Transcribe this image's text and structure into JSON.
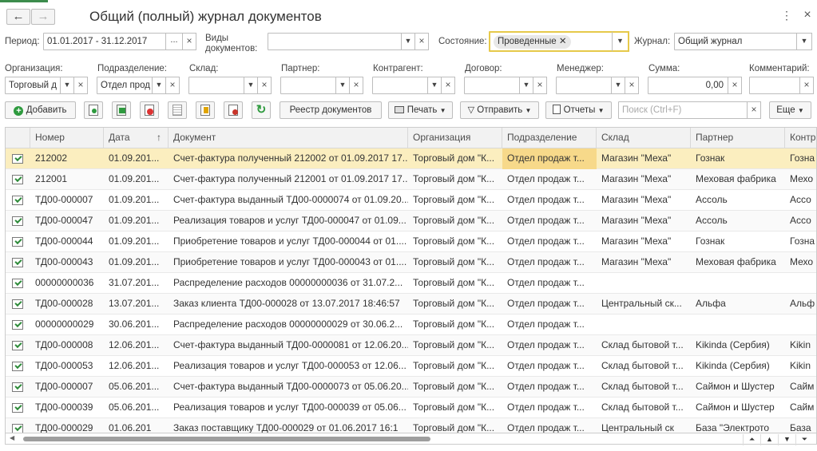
{
  "window": {
    "title": "Общий (полный) журнал документов",
    "more_icon": "⋮",
    "close_icon": "×"
  },
  "filters": {
    "period_label": "Период:",
    "period_value": "01.01.2017 - 31.12.2017",
    "period_btn": "...",
    "doc_types_label": "Виды документов:",
    "state_label": "Состояние:",
    "state_tag": "Проведенные",
    "journal_label": "Журнал:",
    "journal_value": "Общий журнал",
    "org_label": "Организация:",
    "org_value": "Торговый д",
    "dept_label": "Подразделение:",
    "dept_value": "Отдел прод",
    "warehouse_label": "Склад:",
    "partner_label": "Партнер:",
    "counterparty_label": "Контрагент:",
    "contract_label": "Договор:",
    "manager_label": "Менеджер:",
    "sum_label": "Сумма:",
    "sum_value": "0,00",
    "comment_label": "Комментарий:"
  },
  "toolbar": {
    "add": "Добавить",
    "registry": "Реестр документов",
    "print": "Печать",
    "send": "Отправить",
    "reports": "Отчеты",
    "search_placeholder": "Поиск (Ctrl+F)",
    "more": "Еще"
  },
  "columns": [
    "Номер",
    "Дата",
    "Документ",
    "Организация",
    "Подразделение",
    "Склад",
    "Партнер",
    "Контр"
  ],
  "sort_indicator": "↑",
  "rows": [
    {
      "num": "212002",
      "date": "01.09.201...",
      "doc": "Счет-фактура полученный 212002 от 01.09.2017 17...",
      "org": "Торговый дом \"К...",
      "dept": "Отдел продаж т...",
      "wh": "Магазин \"Меха\"",
      "partner": "Гознак",
      "contr": "Гозна"
    },
    {
      "num": "212001",
      "date": "01.09.201...",
      "doc": "Счет-фактура полученный 212001 от 01.09.2017 17...",
      "org": "Торговый дом \"К...",
      "dept": "Отдел продаж т...",
      "wh": "Магазин \"Меха\"",
      "partner": "Меховая фабрика",
      "contr": "Мехо"
    },
    {
      "num": "ТД00-000007",
      "date": "01.09.201...",
      "doc": "Счет-фактура выданный ТД00-0000074 от 01.09.20...",
      "org": "Торговый дом \"К...",
      "dept": "Отдел продаж т...",
      "wh": "Магазин \"Меха\"",
      "partner": "Ассоль",
      "contr": "Ассо"
    },
    {
      "num": "ТД00-000047",
      "date": "01.09.201...",
      "doc": "Реализация товаров и услуг ТД00-000047 от 01.09...",
      "org": "Торговый дом \"К...",
      "dept": "Отдел продаж т...",
      "wh": "Магазин \"Меха\"",
      "partner": "Ассоль",
      "contr": "Ассо"
    },
    {
      "num": "ТД00-000044",
      "date": "01.09.201...",
      "doc": "Приобретение товаров и услуг ТД00-000044 от 01....",
      "org": "Торговый дом \"К...",
      "dept": "Отдел продаж т...",
      "wh": "Магазин \"Меха\"",
      "partner": "Гознак",
      "contr": "Гозна"
    },
    {
      "num": "ТД00-000043",
      "date": "01.09.201...",
      "doc": "Приобретение товаров и услуг ТД00-000043 от 01....",
      "org": "Торговый дом \"К...",
      "dept": "Отдел продаж т...",
      "wh": "Магазин \"Меха\"",
      "partner": "Меховая фабрика",
      "contr": "Мехо"
    },
    {
      "num": "00000000036",
      "date": "31.07.201...",
      "doc": "Распределение расходов 00000000036 от 31.07.2...",
      "org": "Торговый дом \"К...",
      "dept": "Отдел продаж т...",
      "wh": "",
      "partner": "",
      "contr": ""
    },
    {
      "num": "ТД00-000028",
      "date": "13.07.201...",
      "doc": "Заказ клиента ТД00-000028 от 13.07.2017 18:46:57",
      "org": "Торговый дом \"К...",
      "dept": "Отдел продаж т...",
      "wh": "Центральный ск...",
      "partner": "Альфа",
      "contr": "Альф"
    },
    {
      "num": "00000000029",
      "date": "30.06.201...",
      "doc": "Распределение расходов 00000000029 от 30.06.2...",
      "org": "Торговый дом \"К...",
      "dept": "Отдел продаж т...",
      "wh": "",
      "partner": "",
      "contr": ""
    },
    {
      "num": "ТД00-000008",
      "date": "12.06.201...",
      "doc": "Счет-фактура выданный ТД00-0000081 от 12.06.20...",
      "org": "Торговый дом \"К...",
      "dept": "Отдел продаж т...",
      "wh": "Склад бытовой т...",
      "partner": "Kikinda (Сербия)",
      "contr": "Kikin"
    },
    {
      "num": "ТД00-000053",
      "date": "12.06.201...",
      "doc": "Реализация товаров и услуг ТД00-000053 от 12.06...",
      "org": "Торговый дом \"К...",
      "dept": "Отдел продаж т...",
      "wh": "Склад бытовой т...",
      "partner": "Kikinda (Сербия)",
      "contr": "Kikin"
    },
    {
      "num": "ТД00-000007",
      "date": "05.06.201...",
      "doc": "Счет-фактура выданный ТД00-0000073 от 05.06.20...",
      "org": "Торговый дом \"К...",
      "dept": "Отдел продаж т...",
      "wh": "Склад бытовой т...",
      "partner": "Саймон и Шустер",
      "contr": "Сайм"
    },
    {
      "num": "ТД00-000039",
      "date": "05.06.201...",
      "doc": "Реализация товаров и услуг ТД00-000039 от 05.06...",
      "org": "Торговый дом \"К...",
      "dept": "Отдел продаж т...",
      "wh": "Склад бытовой т...",
      "partner": "Саймон и Шустер",
      "contr": "Сайм"
    },
    {
      "num": "ТД00-000029",
      "date": "01.06.201",
      "doc": "Заказ поставщику ТД00-000029 от 01.06.2017 16:1",
      "org": "Торговый дом \"К...",
      "dept": "Отдел продаж т...",
      "wh": "Центральный ск",
      "partner": "База \"Электрото",
      "contr": "База"
    }
  ],
  "colors": {
    "selected_row": "#fbeebf",
    "selected_cell": "#f7d98a",
    "state_border": "#e6c94a",
    "add_icon": "#2e9a3e"
  }
}
